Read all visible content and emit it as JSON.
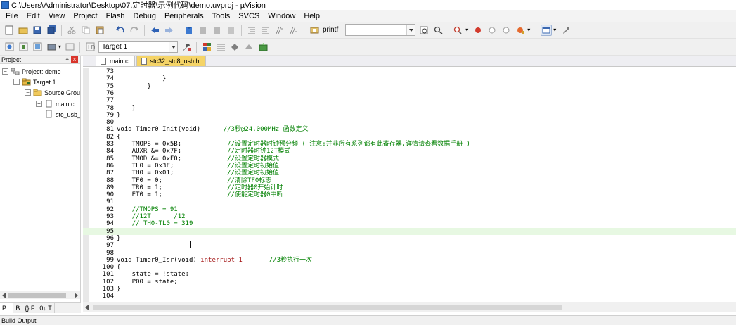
{
  "window": {
    "title": "C:\\Users\\Administrator\\Desktop\\07.定时器\\示例代码\\demo.uvproj - µVision"
  },
  "menu": [
    "File",
    "Edit",
    "View",
    "Project",
    "Flash",
    "Debug",
    "Peripherals",
    "Tools",
    "SVCS",
    "Window",
    "Help"
  ],
  "toolbar": {
    "find_value": "printf",
    "target_value": "Target 1"
  },
  "project_panel": {
    "title": "Project",
    "pin": "⌖",
    "close": "x",
    "tree": [
      {
        "label": "Project: demo",
        "expander": "−",
        "icon": "project-icon"
      },
      {
        "label": "Target 1",
        "expander": "−",
        "icon": "target-icon"
      },
      {
        "label": "Source Group",
        "expander": "−",
        "icon": "folder-icon"
      },
      {
        "label": "main.c",
        "expander": "+",
        "icon": "file-icon"
      },
      {
        "label": "stc_usb_",
        "expander": "",
        "icon": "file-icon"
      }
    ],
    "tabs": [
      "P...",
      "B",
      "{} F",
      "0↓ T"
    ]
  },
  "editor": {
    "tabs": [
      {
        "label": "main.c",
        "active": true
      },
      {
        "label": "stc32_stc8_usb.h",
        "active": false
      }
    ],
    "lines": [
      {
        "n": "73",
        "code": "",
        "comment": ""
      },
      {
        "n": "74",
        "code": "            }",
        "comment": ""
      },
      {
        "n": "75",
        "code": "        }",
        "comment": ""
      },
      {
        "n": "76",
        "code": "",
        "comment": ""
      },
      {
        "n": "77",
        "code": "",
        "comment": ""
      },
      {
        "n": "78",
        "code": "    }",
        "comment": ""
      },
      {
        "n": "79",
        "code": "}",
        "comment": ""
      },
      {
        "n": "80",
        "code": "",
        "comment": ""
      },
      {
        "n": "81",
        "code": "void Timer0_Init(void)      ",
        "comment": "//3秒@24.000MHz 函数定义"
      },
      {
        "n": "82",
        "code": "{",
        "comment": ""
      },
      {
        "n": "83",
        "code": "    TMOPS = 0x5B;            ",
        "comment": "//设置定时器时钟预分频 ( 注意:并非所有系列都有此寄存器,详情请查看数据手册 )"
      },
      {
        "n": "84",
        "code": "    AUXR &= 0x7F;            ",
        "comment": "//定时器时钟12T模式"
      },
      {
        "n": "85",
        "code": "    TMOD &= 0xF0;            ",
        "comment": "//设置定时器模式"
      },
      {
        "n": "86",
        "code": "    TL0 = 0x3F;              ",
        "comment": "//设置定时初始值"
      },
      {
        "n": "87",
        "code": "    TH0 = 0x01;              ",
        "comment": "//设置定时初始值"
      },
      {
        "n": "88",
        "code": "    TF0 = 0;                 ",
        "comment": "//清除TF0标志"
      },
      {
        "n": "89",
        "code": "    TR0 = 1;                 ",
        "comment": "//定时器0开始计时"
      },
      {
        "n": "90",
        "code": "    ET0 = 1;                 ",
        "comment": "//使能定时器0中断"
      },
      {
        "n": "91",
        "code": "",
        "comment": ""
      },
      {
        "n": "92",
        "code": "    ",
        "comment": "//TMOPS = 91"
      },
      {
        "n": "93",
        "code": "    ",
        "comment": "//12T      /12"
      },
      {
        "n": "94",
        "code": "    ",
        "comment": "// TH0-TL0 = 319"
      },
      {
        "n": "95",
        "code": "",
        "comment": ""
      },
      {
        "n": "96",
        "code": "}",
        "comment": ""
      },
      {
        "n": "97",
        "code": "",
        "comment": ""
      },
      {
        "n": "98",
        "code": "",
        "comment": ""
      },
      {
        "n": "99",
        "code": "void Timer0_Isr(void) ",
        "kw": "interrupt 1",
        "code2": "       ",
        "comment": "//3秒执行一次"
      },
      {
        "n": "100",
        "code": "{",
        "comment": ""
      },
      {
        "n": "101",
        "code": "    state = !state;",
        "comment": ""
      },
      {
        "n": "102",
        "code": "    P00 = state;",
        "comment": ""
      },
      {
        "n": "103",
        "code": "}",
        "comment": ""
      },
      {
        "n": "104",
        "code": "",
        "comment": ""
      }
    ]
  },
  "status": {
    "build_output": "Build Output"
  }
}
